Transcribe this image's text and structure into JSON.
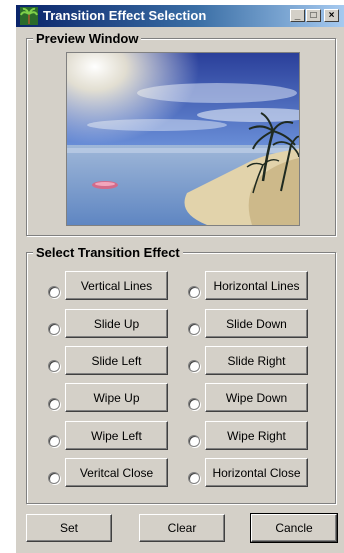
{
  "window": {
    "title": "Transition Effect Selection",
    "icon": "palm-tree-icon"
  },
  "titlebar_buttons": {
    "minimize": "_",
    "maximize": "□",
    "close": "×"
  },
  "preview": {
    "label": "Preview Window"
  },
  "effects": {
    "label": "Select Transition Effect",
    "left": [
      "Vertical Lines",
      "Slide Up",
      "Slide Left",
      "Wipe Up",
      "Wipe Left",
      "Veritcal Close"
    ],
    "right": [
      "Horizontal Lines",
      "Slide Down",
      "Slide Right",
      "Wipe Down",
      "Wipe Right",
      "Horizontal Close"
    ]
  },
  "actions": {
    "set": "Set",
    "clear": "Clear",
    "cancel": "Cancle"
  }
}
